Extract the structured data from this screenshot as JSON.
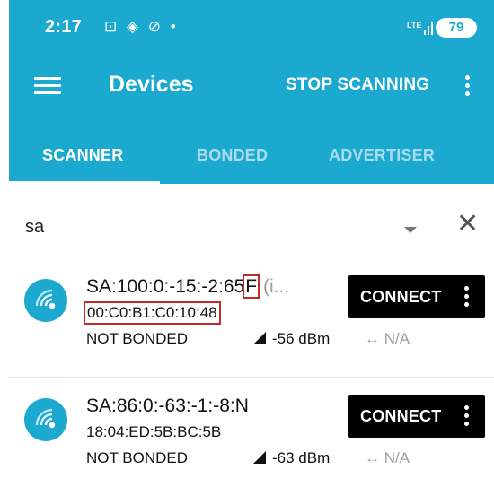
{
  "status_bar": {
    "time": "2:17",
    "notification_icons": "⊡ ◈ ⊘ •",
    "network": "LTE",
    "battery": "79"
  },
  "toolbar": {
    "title": "Devices",
    "stop_scanning": "STOP SCANNING"
  },
  "tabs": [
    {
      "label": "SCANNER",
      "active": true
    },
    {
      "label": "BONDED",
      "active": false
    },
    {
      "label": "ADVERTISER",
      "active": false
    }
  ],
  "filter": {
    "query": "sa"
  },
  "devices": [
    {
      "name": "SA:100:0:-15:-2:65",
      "name_highlight": "F",
      "name_truncated": " (i...",
      "mac": "00:C0:B1:C0:10:48",
      "bond_state": "NOT BONDED",
      "rssi": "-56 dBm",
      "interval": "↔ N/A",
      "connect_label": "CONNECT"
    },
    {
      "name": "SA:86:0:-63:-1:-8:N",
      "mac": "18:04:ED:5B:BC:5B",
      "bond_state": "NOT BONDED",
      "rssi": "-63 dBm",
      "interval": "↔ N/A",
      "connect_label": "CONNECT"
    }
  ],
  "colors": {
    "primary": "#1ba9d0",
    "highlight_box": "#c62828",
    "connect_bg": "#000000"
  }
}
